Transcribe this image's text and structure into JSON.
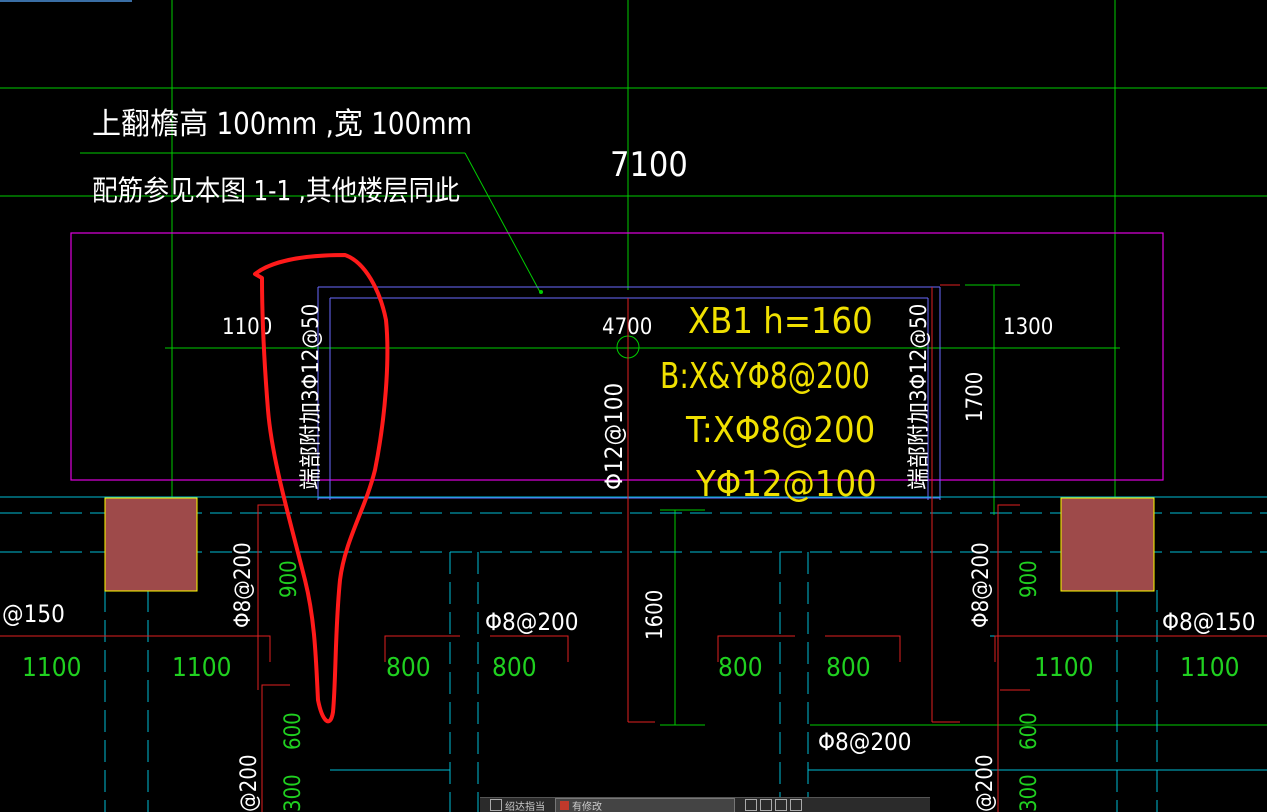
{
  "note": {
    "line1": "上翻檐高  100mm   ,宽  100mm",
    "line2": "配筋参见本图   1-1  ,其他楼层同此"
  },
  "dims": {
    "top_span": "7100",
    "left_span": "1100",
    "mid_span": "4700",
    "right_span": "1300",
    "vert_right": "1700",
    "vert_mid": "1600"
  },
  "slab": {
    "name": "XB1  h=160",
    "bottom": "B:X&YΦ8@200",
    "top_x": "T:XΦ8@200",
    "top_y": "YΦ12@100"
  },
  "rebar": {
    "left_vertical": "端部附加3Φ12@50",
    "right_vertical": "端部附加3Φ12@50",
    "center_vertical": "Φ12@100",
    "left_stirrup_v": "Φ8@200",
    "right_stirrup_v": "Φ8@200",
    "mid_label_1": "Φ8@200",
    "mid_label_2": "Φ8@200",
    "left_edge": "@150",
    "right_edge": "Φ8@150",
    "bottom_left_v": "@200",
    "bottom_right_v": "@200"
  },
  "beam_dims": {
    "row": [
      "1100",
      "1100",
      "800",
      "800",
      "800",
      "800",
      "1100",
      "1100"
    ],
    "v_900_left": "900",
    "v_900_right": "900",
    "v_600_left": "600",
    "v_600_right": "600",
    "v_300_left": "300",
    "v_300_right": "300"
  },
  "taskbar": {
    "item1": "绍达指当",
    "item2": "有修改"
  },
  "colors": {
    "grid": "#00ff00",
    "slab": "#ff00ff",
    "inner": "#6666ff",
    "text_white": "#ffffff",
    "text_yellow": "#ffff00",
    "text_green": "#00ff00",
    "column_fill": "#9e4a4a",
    "column_edge": "#ffff00",
    "annotation": "#ff2020"
  }
}
